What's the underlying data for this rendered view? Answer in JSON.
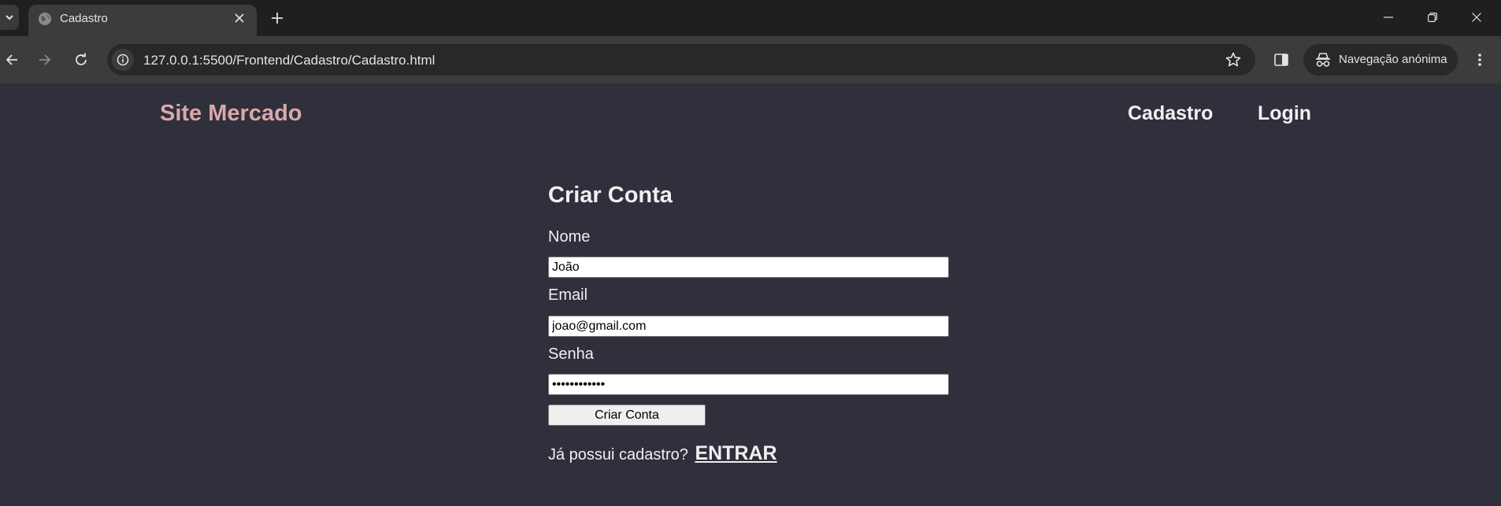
{
  "browser": {
    "tab": {
      "title": "Cadastro"
    },
    "url": "127.0.0.1:5500/Frontend/Cadastro/Cadastro.html",
    "incognito_label": "Navegação anónima",
    "icons": [
      "tab-list-icon",
      "globe-icon",
      "close-icon",
      "plus-icon",
      "minimize-icon",
      "restore-icon",
      "window-close-icon",
      "back-arrow-icon",
      "forward-arrow-icon",
      "reload-icon",
      "info-icon",
      "star-icon",
      "side-panel-icon",
      "incognito-icon",
      "kebab-menu-icon"
    ]
  },
  "header": {
    "brand": "Site Mercado",
    "nav": [
      {
        "label": "Cadastro"
      },
      {
        "label": "Login"
      }
    ]
  },
  "form": {
    "title": "Criar Conta",
    "fields": [
      {
        "label": "Nome",
        "value": "João"
      },
      {
        "label": "Email",
        "value": "joao@gmail.com"
      },
      {
        "label": "Senha",
        "value": "••••••••••••"
      }
    ],
    "submit_label": "Criar Conta",
    "login_prompt": "Já possui cadastro?",
    "login_link": "ENTRAR"
  },
  "colors": {
    "page_background": "#302f3c",
    "brand": "#d8a9a9",
    "text": "#f0f0f0",
    "chrome_tabbar": "#1f1f1f",
    "chrome_toolbar": "#3c3c3c"
  }
}
